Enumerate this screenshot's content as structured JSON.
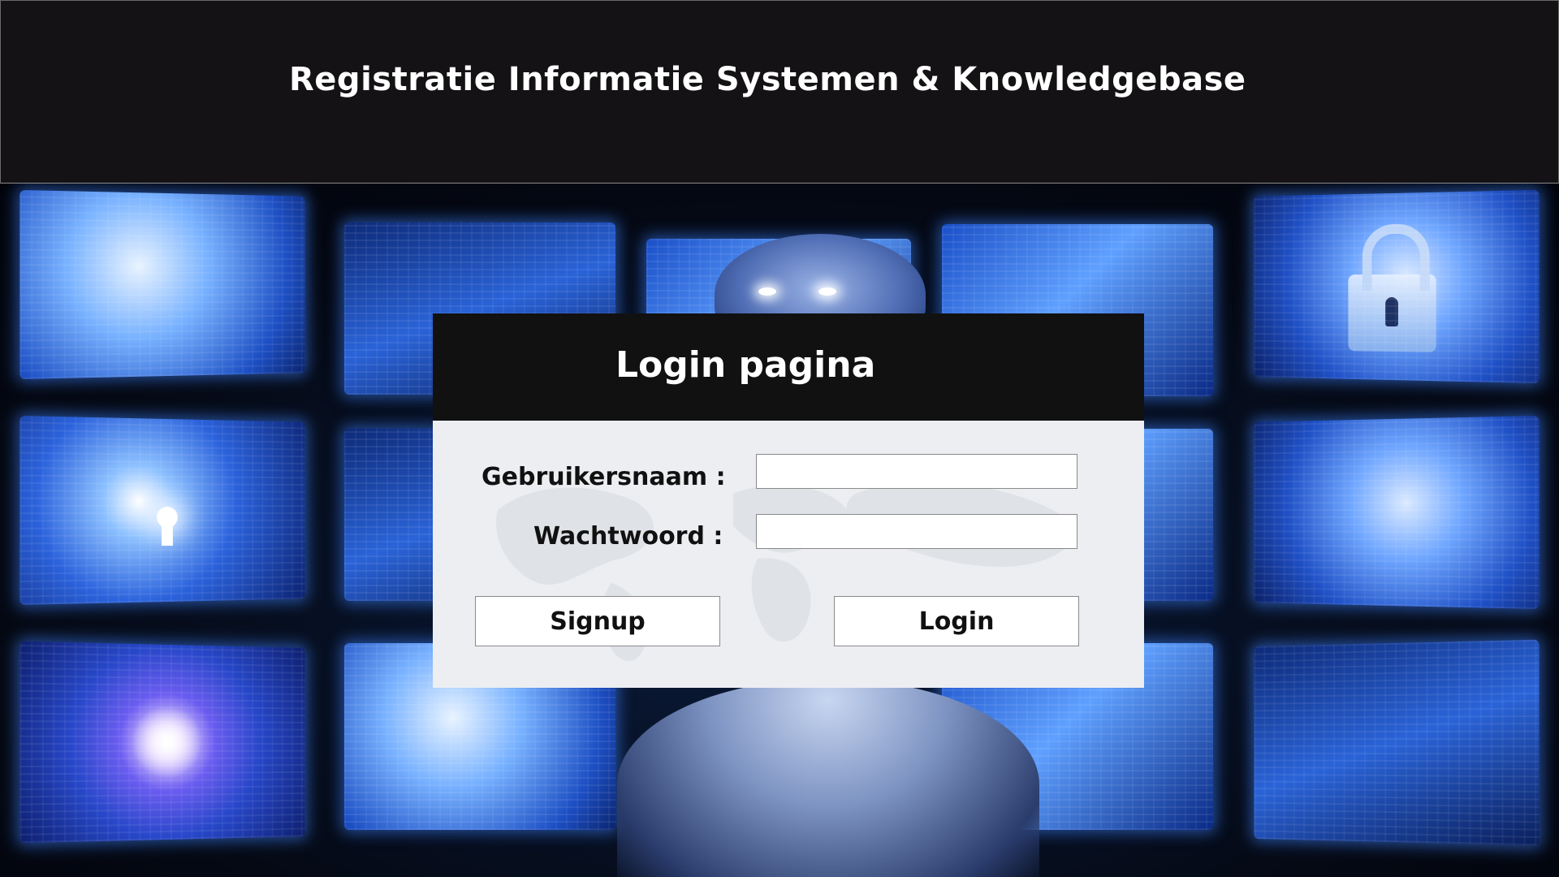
{
  "header": {
    "title": "Registratie Informatie Systemen & Knowledgebase"
  },
  "login": {
    "title": "Login pagina",
    "username_label": "Gebruikersnaam :",
    "username_value": "",
    "password_label": "Wachtwoord :",
    "password_value": "",
    "signup_label": "Signup",
    "login_label": "Login"
  },
  "colors": {
    "header_bg": "#141214",
    "login_header_bg": "#111111",
    "login_body_bg": "#eceef2",
    "accent_glow": "#3c82ff"
  },
  "icons": [
    "padlock-icon",
    "keyhole-icon"
  ]
}
